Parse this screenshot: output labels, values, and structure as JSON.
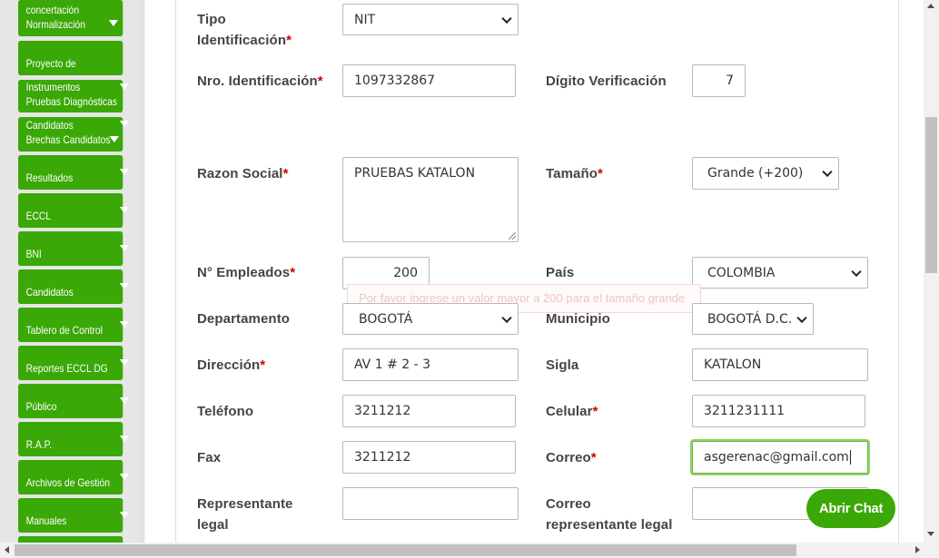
{
  "sidebar": {
    "items": [
      {
        "label1": "concertación",
        "label2": "Normalización"
      },
      {
        "label": "Proyecto de"
      },
      {
        "label1": "Instrumentos",
        "label2": "Pruebas Diagnósticas"
      },
      {
        "label1": "Candidatos",
        "label2": "Brechas Candidatos"
      },
      {
        "label": "Resultados"
      },
      {
        "label": "ECCL"
      },
      {
        "label": "BNI"
      },
      {
        "label": "Candidatos"
      },
      {
        "label": "Tablero de Control"
      },
      {
        "label": "Reportes ECCL DG"
      },
      {
        "label": "Público"
      },
      {
        "label": "R.A.P."
      },
      {
        "label": "Archivos de Gestión"
      },
      {
        "label": "Manuales"
      }
    ]
  },
  "form": {
    "tipo_identificacion": {
      "label_line1": "Tipo",
      "label_line2": "Identificación",
      "required": "*",
      "value": "NIT"
    },
    "nro_identificacion": {
      "label": "Nro. Identificación",
      "required": "*",
      "value": "1097332867"
    },
    "digito_verificacion": {
      "label": "Dígito Verificación",
      "value": "7"
    },
    "razon_social": {
      "label": "Razon Social",
      "required": "*",
      "value": "PRUEBAS KATALON"
    },
    "tamano": {
      "label": "Tamaño",
      "required": "*",
      "value": "Grande (+200)"
    },
    "empleados": {
      "label": "N° Empleados",
      "required": "*",
      "value": "200"
    },
    "pais": {
      "label": "País",
      "value": "COLOMBIA"
    },
    "validation_message": "Por favor ingrese un valor mayor a 200 para el tamaño grande",
    "departamento": {
      "label": "Departamento",
      "value": "BOGOTÁ"
    },
    "municipio": {
      "label": "Municipio",
      "value": "BOGOTÁ D.C."
    },
    "direccion": {
      "label": "Dirección",
      "required": "*",
      "value": "AV 1 # 2 - 3"
    },
    "sigla": {
      "label": "Sigla",
      "value": "KATALON"
    },
    "telefono": {
      "label": "Teléfono",
      "value": "3211212"
    },
    "celular": {
      "label": "Celular",
      "required": "*",
      "value": "3211231111"
    },
    "fax": {
      "label": "Fax",
      "value": "3211212"
    },
    "correo": {
      "label": "Correo",
      "required": "*",
      "value": "asgerenac@gmail.com"
    },
    "representante_legal": {
      "label_line1": "Representante",
      "label_line2": "legal",
      "value": ""
    },
    "correo_representante": {
      "label_line1": "Correo",
      "label_line2": "representante legal",
      "value": ""
    }
  },
  "chat": {
    "label": "Abrir Chat"
  },
  "colors": {
    "accent": "#3aa806",
    "required": "#cc0000"
  }
}
